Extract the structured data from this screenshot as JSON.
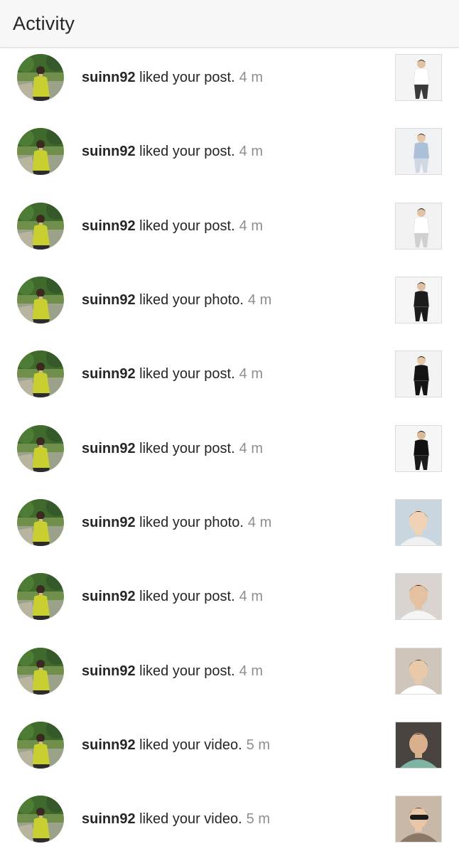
{
  "header": {
    "title": "Activity"
  },
  "items": [
    {
      "username": "suinn92",
      "action": "liked your post.",
      "time": "4 m",
      "thumb": "studio-white-sitting"
    },
    {
      "username": "suinn92",
      "action": "liked your post.",
      "time": "4 m",
      "thumb": "denim-jacket"
    },
    {
      "username": "suinn92",
      "action": "liked your post.",
      "time": "4 m",
      "thumb": "white-shirt-lounging"
    },
    {
      "username": "suinn92",
      "action": "liked your photo.",
      "time": "4 m",
      "thumb": "black-shirt"
    },
    {
      "username": "suinn92",
      "action": "liked your post.",
      "time": "4 m",
      "thumb": "black-track-jacket"
    },
    {
      "username": "suinn92",
      "action": "liked your post.",
      "time": "4 m",
      "thumb": "black-tee-standing"
    },
    {
      "username": "suinn92",
      "action": "liked your photo.",
      "time": "4 m",
      "thumb": "selfie-closeup"
    },
    {
      "username": "suinn92",
      "action": "liked your post.",
      "time": "4 m",
      "thumb": "gym-tank-top"
    },
    {
      "username": "suinn92",
      "action": "liked your post.",
      "time": "4 m",
      "thumb": "white-tee-selfie"
    },
    {
      "username": "suinn92",
      "action": "liked your video.",
      "time": "5 m",
      "thumb": "car-selfie"
    },
    {
      "username": "suinn92",
      "action": "liked your video.",
      "time": "5 m",
      "thumb": "sunglasses-selfie"
    }
  ]
}
